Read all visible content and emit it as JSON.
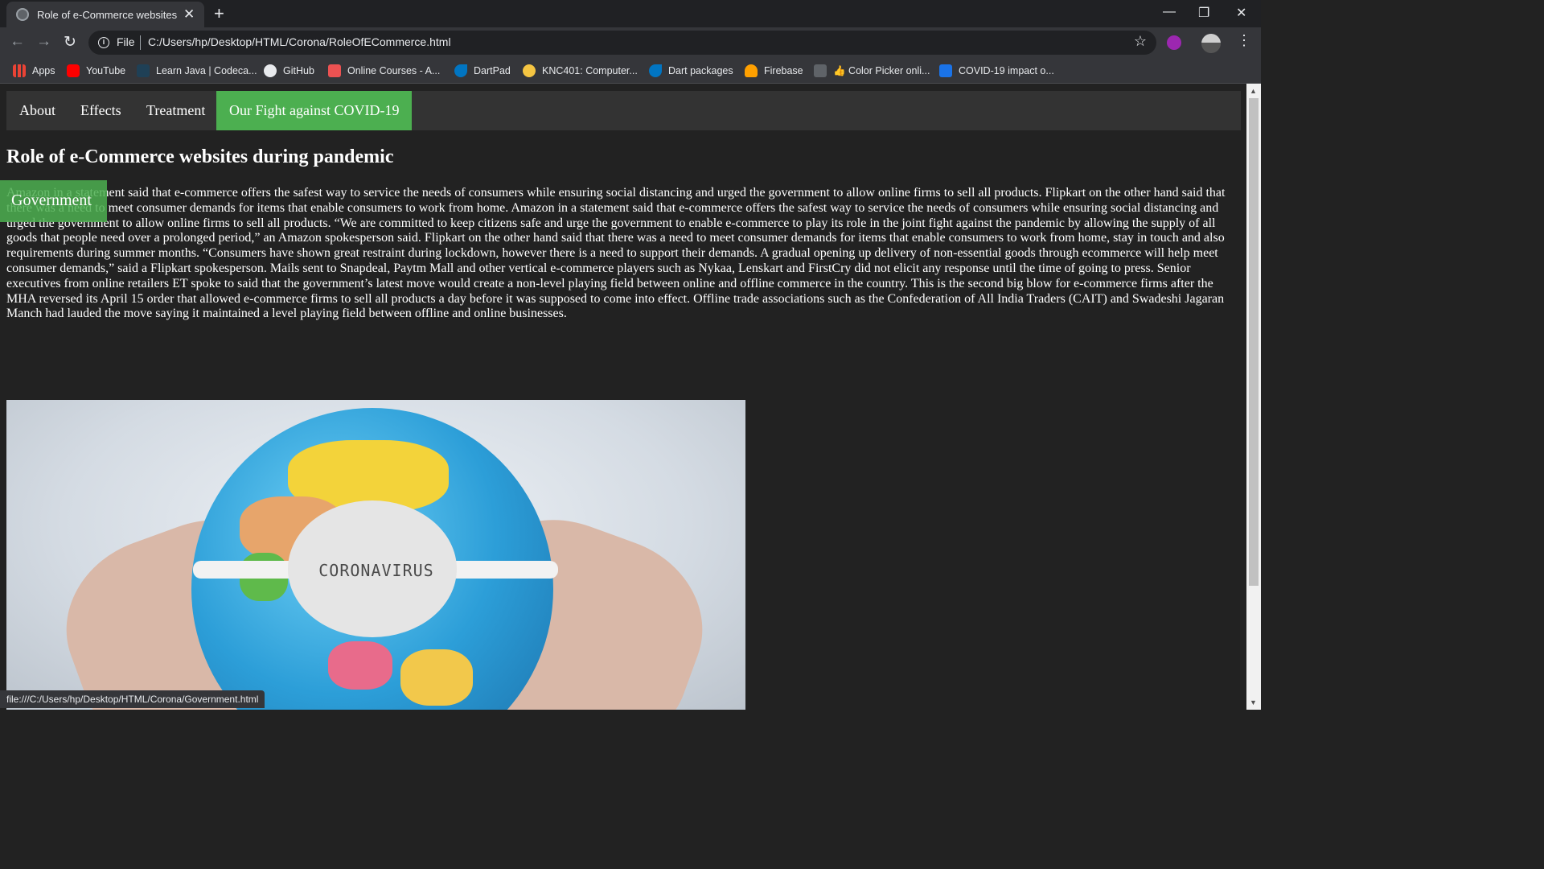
{
  "browser": {
    "tab_title": "Role of e-Commerce websites du",
    "tab_close": "✕",
    "new_tab": "+",
    "window_controls": {
      "minimize": "—",
      "restore": "❐",
      "close": "✕"
    },
    "nav": {
      "back": "←",
      "forward": "→",
      "reload": "↻"
    },
    "address": {
      "scheme": "File",
      "url": "C:/Users/hp/Desktop/HTML/Corona/RoleOfECommerce.html",
      "info": "i"
    },
    "star": "☆",
    "menu": "⋮",
    "bookmarks": [
      {
        "label": "Apps",
        "icon": "apps-grid-icon",
        "color": "#ea4335"
      },
      {
        "label": "YouTube",
        "icon": "youtube-icon",
        "color": "#ff0000"
      },
      {
        "label": "Learn Java | Codeca...",
        "icon": "codecademy-icon",
        "color": "#1f4056"
      },
      {
        "label": "GitHub",
        "icon": "github-icon",
        "color": "#e8eaed"
      },
      {
        "label": "Online Courses - A...",
        "icon": "udemy-icon",
        "color": "#ec5252"
      },
      {
        "label": "DartPad",
        "icon": "dart-icon",
        "color": "#0175c2"
      },
      {
        "label": "KNC401: Computer...",
        "icon": "knc-icon",
        "color": "#f5c542"
      },
      {
        "label": "Dart packages",
        "icon": "dart-icon",
        "color": "#0175c2"
      },
      {
        "label": "Firebase",
        "icon": "firebase-icon",
        "color": "#ffa000"
      },
      {
        "label": "👍 Color Picker onli...",
        "icon": "color-picker-icon",
        "color": "#5f6368"
      },
      {
        "label": "COVID-19 impact o...",
        "icon": "dh-icon",
        "color": "#1a73e8"
      }
    ],
    "status_url": "file:///C:/Users/hp/Desktop/HTML/Corona/Government.html"
  },
  "navbar": {
    "items": [
      {
        "label": "About"
      },
      {
        "label": "Effects"
      },
      {
        "label": "Treatment"
      },
      {
        "label": "Our Fight against COVID-19"
      }
    ],
    "dropdown_item": "Government",
    "active_color": "#4caf50"
  },
  "article": {
    "title": "Role of e-Commerce websites during pandemic",
    "body": "Amazon in a statement said that e-commerce offers the safest way to service the needs of consumers while ensuring social distancing and urged the government to allow online firms to sell all products. Flipkart on the other hand said that there was a need to meet consumer demands for items that enable consumers to work from home. Amazon in a statement said that e-commerce offers the safest way to service the needs of consumers while ensuring social distancing and urged the government to allow online firms to sell all products. “We are committed to keep citizens safe and urge the government to enable e-commerce to play its role in the joint fight against the pandemic by allowing the supply of all goods that people need over a prolonged period,” an Amazon spokesperson said. Flipkart on the other hand said that there was a need to meet consumer demands for items that enable consumers to work from home, stay in touch and also requirements during summer months. “Consumers have shown great restraint during lockdown, however there is a need to support their demands. A gradual opening up delivery of non-essential goods through ecommerce will help meet consumer demands,” said a Flipkart spokesperson. Mails sent to Snapdeal, Paytm Mall and other vertical e-commerce players such as Nykaa, Lenskart and FirstCry did not elicit any response until the time of going to press. Senior executives from online retailers ET spoke to said that the government’s latest move would create a non-level playing field between online and offline commerce in the country. This is the second big blow for e-commerce firms after the MHA reversed its April 15 order that allowed e-commerce firms to sell all products a day before it was supposed to come into effect. Offline trade associations such as the Confederation of All India Traders (CAIT) and Swadeshi Jagaran Manch had lauded the move saying it maintained a level playing field between offline and online businesses.",
    "image_text": "CORONAVIRUS"
  }
}
